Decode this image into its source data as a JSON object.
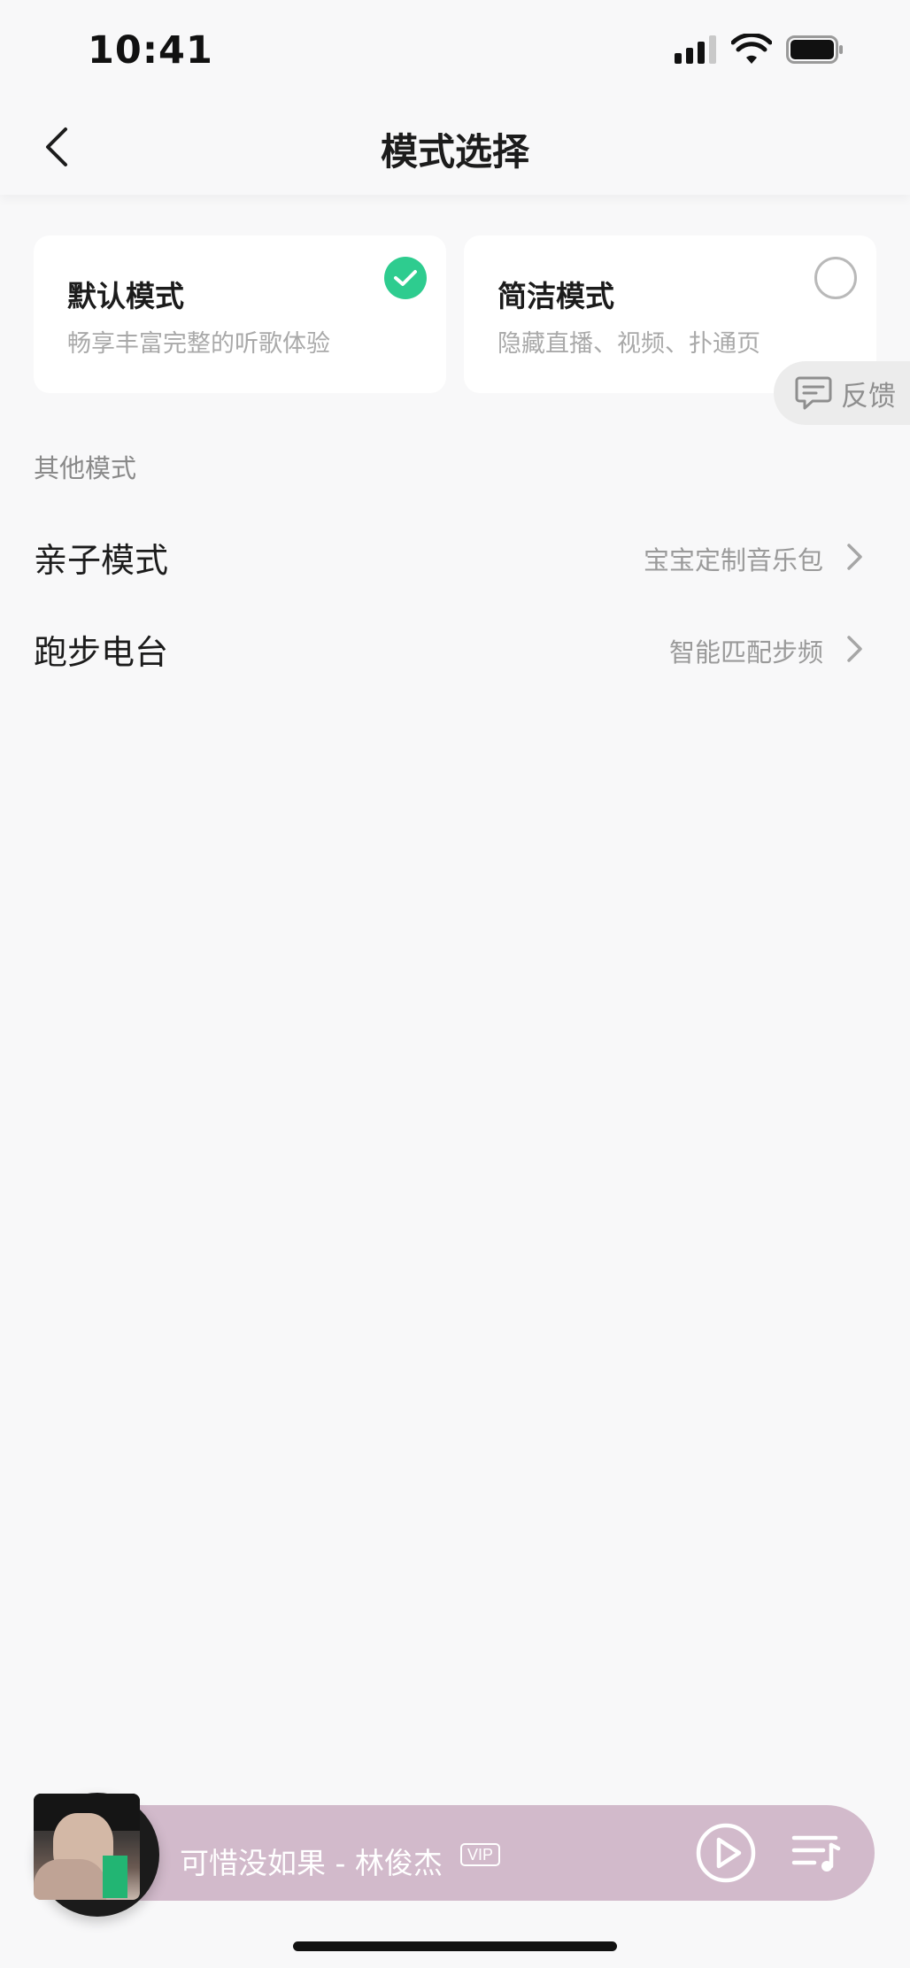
{
  "status_bar": {
    "time": "10:41"
  },
  "nav": {
    "title": "模式选择",
    "back_icon": "chevron-left-icon"
  },
  "modes": [
    {
      "title": "默认模式",
      "description": "畅享丰富完整的听歌体验",
      "selected": true,
      "icon": "check-circle-icon"
    },
    {
      "title": "简洁模式",
      "description": "隐藏直播、视频、扑通页",
      "selected": false,
      "icon": "radio-circle-icon"
    }
  ],
  "feedback": {
    "label": "反馈",
    "icon": "message-icon"
  },
  "other_modes": {
    "header": "其他模式",
    "items": [
      {
        "title": "亲子模式",
        "subtitle": "宝宝定制音乐包"
      },
      {
        "title": "跑步电台",
        "subtitle": "智能匹配步频"
      }
    ]
  },
  "player": {
    "track": "可惜没如果 - 林俊杰",
    "badge": "VIP",
    "accent_color": "#d2bacb",
    "check_color": "#2ecc8f"
  }
}
